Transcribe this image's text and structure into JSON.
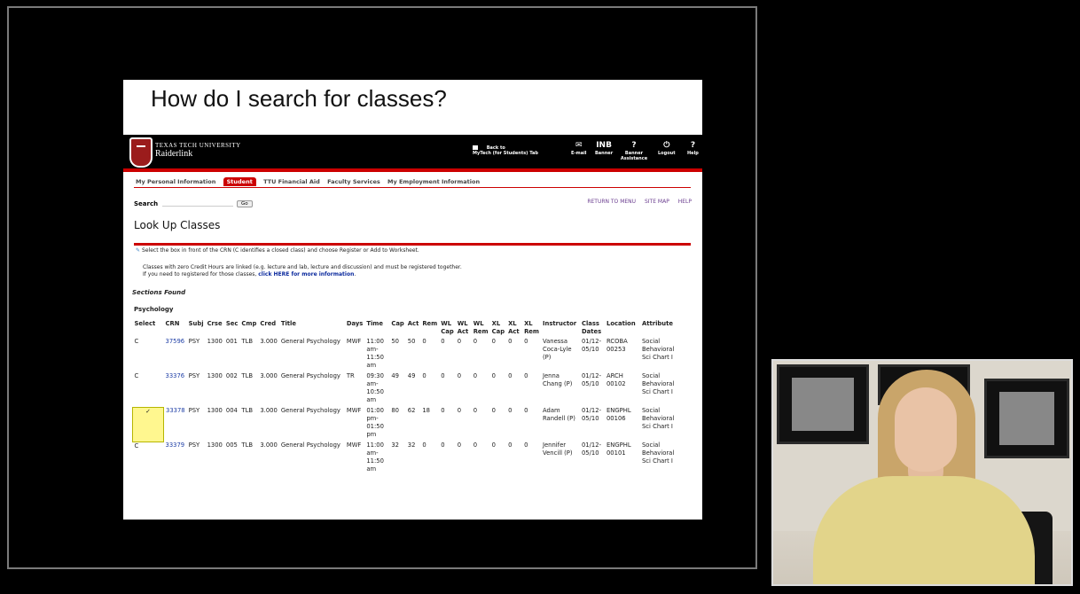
{
  "slide": {
    "title": "How do I search for classes?"
  },
  "banner": {
    "university": "TEXAS TECH UNIVERSITY",
    "app_name": "Raiderlink",
    "back_link_line1": "Back to",
    "back_link_line2": "MyTech (for Students) Tab",
    "nav": [
      {
        "icon": "✉",
        "label": "E-mail"
      },
      {
        "icon": "INB",
        "label": "Banner"
      },
      {
        "icon": "?",
        "label": "Banner Assistance"
      },
      {
        "icon": "⏻",
        "label": "Logout"
      },
      {
        "icon": "?",
        "label": "Help"
      }
    ]
  },
  "tabs": [
    "My Personal Information",
    "Student",
    "TTU Financial Aid",
    "Faculty Services",
    "My Employment Information"
  ],
  "active_tab": "Student",
  "search": {
    "label": "Search",
    "value": "",
    "button": "Go"
  },
  "top_links": [
    "RETURN TO MENU",
    "SITE MAP",
    "HELP"
  ],
  "page_title": "Look Up Classes",
  "instructions": {
    "line1": "Select the box in front of the CRN (C identifies a closed class) and choose Register or Add to Worksheet.",
    "line2": "Classes with zero Credit Hours are linked (e.g. lecture and lab, lecture and discussion) and must be registered together.",
    "line3": "If you need to registered for those classes,",
    "link": "click HERE for more information",
    "link_after": "."
  },
  "sections_found": "Sections Found",
  "subject": "Psychology",
  "table": {
    "headers": [
      "Select",
      "CRN",
      "Subj",
      "Crse",
      "Sec",
      "Cmp",
      "Cred",
      "Title",
      "Days",
      "Time",
      "Cap",
      "Act",
      "Rem",
      "WL Cap",
      "WL Act",
      "WL Rem",
      "XL Cap",
      "XL Act",
      "XL Rem",
      "Instructor",
      "Class Dates",
      "Location",
      "Attribute"
    ],
    "rows": [
      {
        "select": "C",
        "crn": "37596",
        "subj": "PSY",
        "crse": "1300",
        "sec": "001",
        "cmp": "TLB",
        "cred": "3.000",
        "title": "General Psychology",
        "days": "MWF",
        "time": "11:00 am-11:50 am",
        "cap": "50",
        "act": "50",
        "rem": "0",
        "wlcap": "0",
        "wlact": "0",
        "wlrem": "0",
        "xlcap": "0",
        "xlact": "0",
        "xlrem": "0",
        "instructor": "Vanessa Coca-Lyle (P)",
        "dates": "01/12-05/10",
        "location": "RCOBA 00253",
        "attribute": "Social Behavioral Sci Chart I"
      },
      {
        "select": "C",
        "crn": "33376",
        "subj": "PSY",
        "crse": "1300",
        "sec": "002",
        "cmp": "TLB",
        "cred": "3.000",
        "title": "General Psychology",
        "days": "TR",
        "time": "09:30 am-10:50 am",
        "cap": "49",
        "act": "49",
        "rem": "0",
        "wlcap": "0",
        "wlact": "0",
        "wlrem": "0",
        "xlcap": "0",
        "xlact": "0",
        "xlrem": "0",
        "instructor": "Jenna Chang (P)",
        "dates": "01/12-05/10",
        "location": "ARCH 00102",
        "attribute": "Social Behavioral Sci Chart I"
      },
      {
        "select": "✓",
        "checked": true,
        "crn": "33378",
        "subj": "PSY",
        "crse": "1300",
        "sec": "004",
        "cmp": "TLB",
        "cred": "3.000",
        "title": "General Psychology",
        "days": "MWF",
        "time": "01:00 pm-01:50 pm",
        "cap": "80",
        "act": "62",
        "rem": "18",
        "wlcap": "0",
        "wlact": "0",
        "wlrem": "0",
        "xlcap": "0",
        "xlact": "0",
        "xlrem": "0",
        "instructor": "Adam Randell (P)",
        "dates": "01/12-05/10",
        "location": "ENGPHL 00106",
        "attribute": "Social Behavioral Sci Chart I"
      },
      {
        "select": "C",
        "crn": "33379",
        "subj": "PSY",
        "crse": "1300",
        "sec": "005",
        "cmp": "TLB",
        "cred": "3.000",
        "title": "General Psychology",
        "days": "MWF",
        "time": "11:00 am-11:50 am",
        "cap": "32",
        "act": "32",
        "rem": "0",
        "wlcap": "0",
        "wlact": "0",
        "wlrem": "0",
        "xlcap": "0",
        "xlact": "0",
        "xlrem": "0",
        "instructor": "Jennifer Vencill (P)",
        "dates": "01/12-05/10",
        "location": "ENGPHL 00101",
        "attribute": "Social Behavioral Sci Chart I"
      }
    ]
  }
}
